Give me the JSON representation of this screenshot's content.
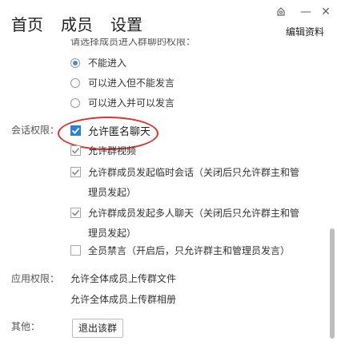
{
  "tabs": [
    "首页",
    "成员",
    "设置"
  ],
  "window_controls": {
    "pin_icon": "pin-icon",
    "minimize": "—",
    "close": "✕"
  },
  "edit_profile": "编辑资料",
  "cut_text": "请选择成员进入群聊的权限：",
  "entry_options": [
    {
      "label": "不能进入",
      "selected": true
    },
    {
      "label": "可以进入但不能发言",
      "selected": false
    },
    {
      "label": "可以进入并可以发言",
      "selected": false
    }
  ],
  "session_permission": {
    "label": "会话权限：",
    "options": [
      {
        "label": "允许匿名聊天",
        "checked": true
      },
      {
        "label": "允许群视频",
        "checked": true
      },
      {
        "label": "允许群成员发起临时会话（关闭后只允许群主和管",
        "label2": "理员发起）",
        "checked": true
      },
      {
        "label": "允许群成员发起多人聊天（关闭后只允许群主和管",
        "label2": "理员发起）",
        "checked": true
      },
      {
        "label": "全员禁言（开启后，只允许群主和管理员发言）",
        "checked": false
      }
    ]
  },
  "app_permission": {
    "label": "应用权限：",
    "items": [
      "允许全体成员上传群文件",
      "允许全体成员上传群相册"
    ]
  },
  "other": {
    "label": "其他：",
    "button": "退出该群"
  },
  "colors": {
    "accent_blue": "#2a82d8",
    "highlight_red": "#e0322e"
  }
}
